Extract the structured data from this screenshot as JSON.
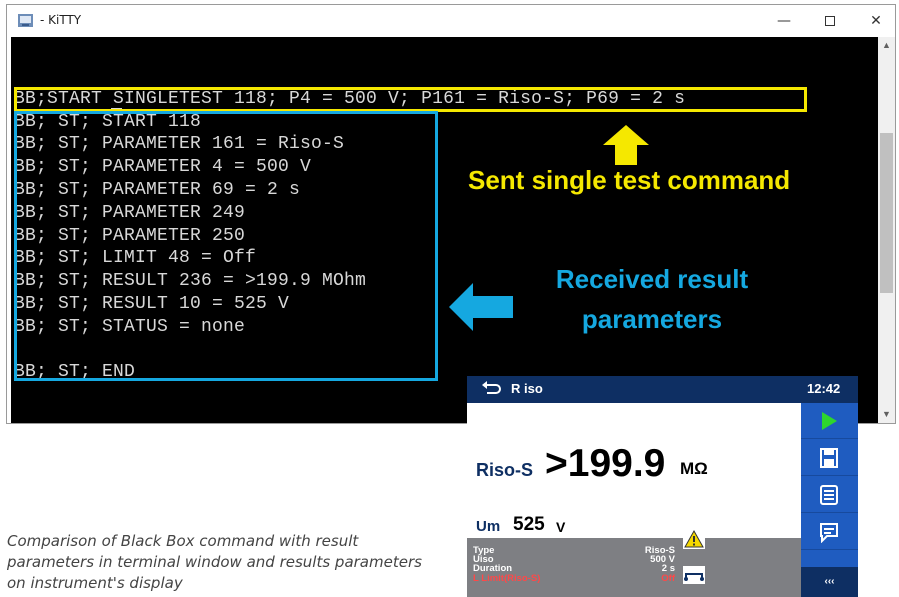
{
  "window": {
    "title": "- KiTTY",
    "minimize": "—",
    "close": "✕"
  },
  "terminal": {
    "command": "BB;START SINGLETEST 118; P4 = 500 V; P161 = Riso-S; P69 = 2 s",
    "lines": [
      "BB; ST; START 118",
      "BB; ST; PARAMETER 161 = Riso-S",
      "BB; ST; PARAMETER 4 = 500 V",
      "BB; ST; PARAMETER 69 = 2 s",
      "BB; ST; PARAMETER 249",
      "BB; ST; PARAMETER 250",
      "BB; ST; LIMIT 48 = Off",
      "BB; ST; RESULT 236 = >199.9 MOhm",
      "BB; ST; RESULT 10 = 525 V",
      "BB; ST; STATUS = none",
      "",
      "BB; ST; END"
    ]
  },
  "annotations": {
    "sent": "Sent single test command",
    "received": "Received result parameters",
    "colors": {
      "sent": "#f5e800",
      "received": "#15a8e0"
    }
  },
  "caption": "Comparison of Black Box command with result parameters in terminal window and results parameters on instrument's display",
  "instrument": {
    "title": "R iso",
    "clock": "12:42",
    "result_label": "Riso-S",
    "result_value": ">199.9",
    "result_unit": "MΩ",
    "um_label": "Um",
    "um_value": "525",
    "um_unit": "V",
    "params": [
      {
        "name": "Type",
        "value": "Riso-S"
      },
      {
        "name": "Uiso",
        "value": "500 V"
      },
      {
        "name": "Duration",
        "value": "2 s"
      },
      {
        "name": "L Limit(Riso-S)",
        "value": "Off"
      }
    ],
    "side_buttons": [
      "start-icon",
      "save-icon",
      "list-icon",
      "comment-icon"
    ],
    "more_label": "‹‹‹",
    "colors": {
      "header": "#0e2f63",
      "side": "#1f5cc0",
      "params_bg": "#7e7f83"
    }
  }
}
